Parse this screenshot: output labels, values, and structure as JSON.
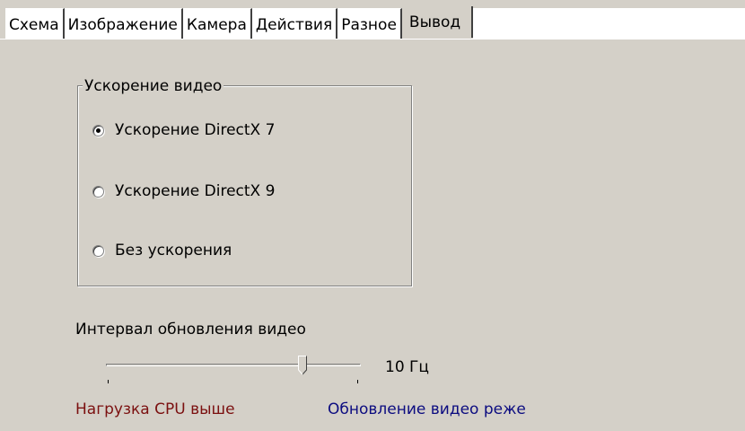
{
  "tabs": [
    {
      "label": "Схема",
      "active": false
    },
    {
      "label": "Изображение",
      "active": false
    },
    {
      "label": "Камера",
      "active": false
    },
    {
      "label": "Действия",
      "active": false
    },
    {
      "label": "Разное",
      "active": false
    },
    {
      "label": "Вывод",
      "active": true
    }
  ],
  "video_acceleration": {
    "group_title": "Ускорение видео",
    "options": [
      {
        "label": "Ускорение DirectX 7",
        "selected": true
      },
      {
        "label": "Ускорение DirectX 9",
        "selected": false
      },
      {
        "label": "Без ускорения",
        "selected": false
      }
    ]
  },
  "refresh_interval": {
    "label": "Интервал обновления видео",
    "value_text": "10 Гц",
    "slider_fraction": 0.77,
    "hint_left": "Нагрузка CPU выше",
    "hint_right": "Обновление видео реже"
  },
  "colors": {
    "background": "#d4d0c8",
    "hint_left": "#7b1010",
    "hint_right": "#0c0c80"
  }
}
